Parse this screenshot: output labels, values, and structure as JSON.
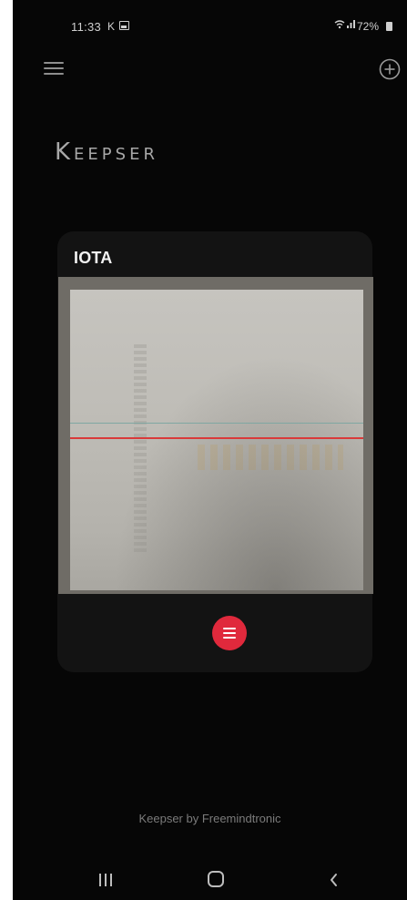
{
  "status_bar": {
    "time": "11:33",
    "notification_k": "K",
    "battery": "72%"
  },
  "header": {
    "app_title": "Keepser"
  },
  "card": {
    "title": "IOTA"
  },
  "footer": {
    "text": "Keepser by Freemindtronic"
  },
  "colors": {
    "background": "#060606",
    "card": "#131313",
    "accent_red": "#e0293c",
    "scan_line": "#d93a3a"
  },
  "icons": {
    "menu": "hamburger-menu-icon",
    "add": "plus-circle-icon",
    "card_menu": "list-menu-icon",
    "nav_recents": "recent-apps-icon",
    "nav_home": "home-icon",
    "nav_back": "back-chevron-icon"
  }
}
